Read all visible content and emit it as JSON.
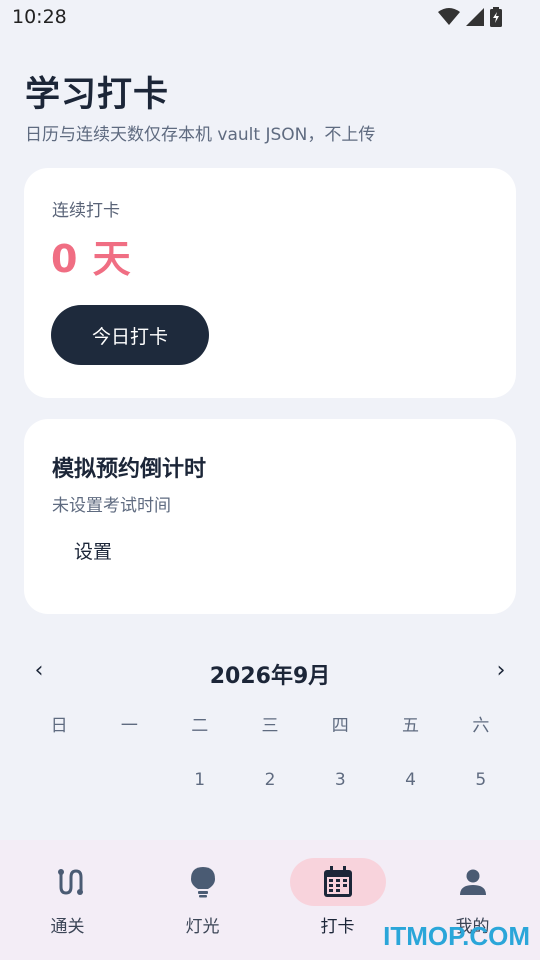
{
  "status_bar": {
    "time": "10:28"
  },
  "page": {
    "title": "学习打卡",
    "subtitle": "日历与连续天数仅存本机 vault JSON，不上传"
  },
  "streak_card": {
    "label": "连续打卡",
    "value": "0 天",
    "checkin_button": "今日打卡"
  },
  "exam_card": {
    "title": "模拟预约倒计时",
    "subtitle": "未设置考试时间",
    "settings_button": "设置"
  },
  "calendar": {
    "prev": "‹",
    "next": "›",
    "month": "2026年9月",
    "weekdays": [
      "日",
      "一",
      "二",
      "三",
      "四",
      "五",
      "六"
    ],
    "first_row": [
      "",
      "",
      "1",
      "2",
      "3",
      "4",
      "5"
    ]
  },
  "bottom_nav": {
    "items": [
      {
        "label": "通关",
        "icon": "route-icon"
      },
      {
        "label": "灯光",
        "icon": "lightbulb-icon"
      },
      {
        "label": "打卡",
        "icon": "calendar-icon",
        "active": true
      },
      {
        "label": "我的",
        "icon": "person-icon"
      }
    ]
  },
  "colors": {
    "background": "#f0f2f8",
    "accent_pink": "#f06e83",
    "button_dark": "#1e2a3c",
    "nav_active_pill": "#f8d3dc"
  },
  "watermark": "ITMOP.COM"
}
